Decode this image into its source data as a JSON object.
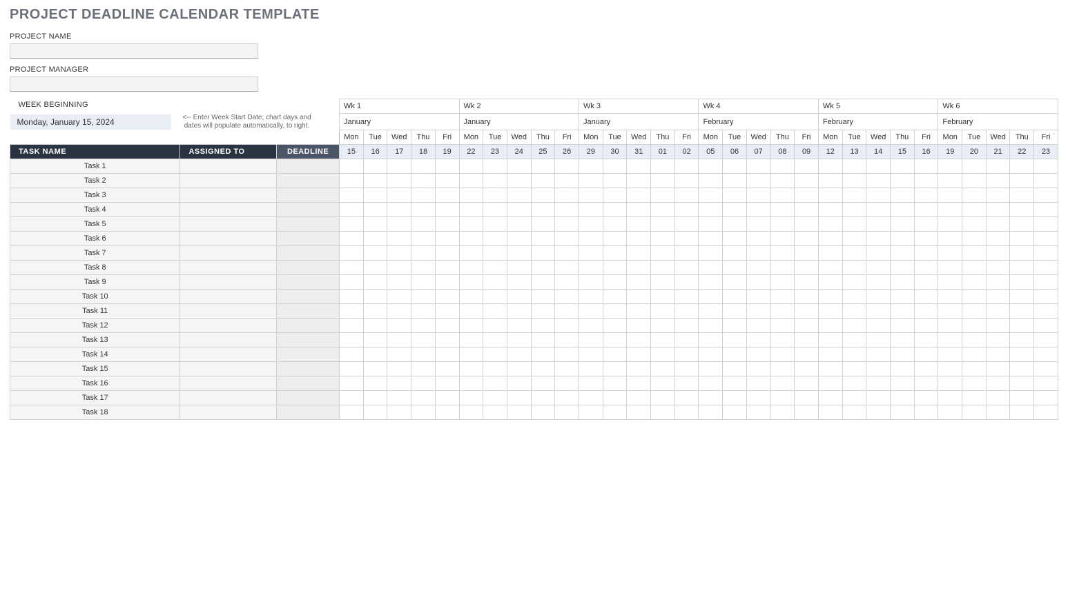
{
  "title": "PROJECT DEADLINE CALENDAR TEMPLATE",
  "labels": {
    "project_name": "PROJECT NAME",
    "project_manager": "PROJECT MANAGER",
    "week_beginning": "WEEK BEGINNING",
    "date_hint": "<-- Enter Week Start Date; chart days and dates will populate automatically, to right."
  },
  "inputs": {
    "project_name": "",
    "project_manager": "",
    "week_beginning": "Monday, January 15, 2024"
  },
  "columns": {
    "task": "TASK NAME",
    "assigned": "ASSIGNED TO",
    "deadline": "DEADLINE"
  },
  "weeks": [
    {
      "label": "Wk 1",
      "month": "January",
      "days": [
        "Mon",
        "Tue",
        "Wed",
        "Thu",
        "Fri"
      ],
      "dates": [
        "15",
        "16",
        "17",
        "18",
        "19"
      ]
    },
    {
      "label": "Wk 2",
      "month": "January",
      "days": [
        "Mon",
        "Tue",
        "Wed",
        "Thu",
        "Fri"
      ],
      "dates": [
        "22",
        "23",
        "24",
        "25",
        "26"
      ]
    },
    {
      "label": "Wk 3",
      "month": "January",
      "days": [
        "Mon",
        "Tue",
        "Wed",
        "Thu",
        "Fri"
      ],
      "dates": [
        "29",
        "30",
        "31",
        "01",
        "02"
      ]
    },
    {
      "label": "Wk 4",
      "month": "February",
      "days": [
        "Mon",
        "Tue",
        "Wed",
        "Thu",
        "Fri"
      ],
      "dates": [
        "05",
        "06",
        "07",
        "08",
        "09"
      ]
    },
    {
      "label": "Wk 5",
      "month": "February",
      "days": [
        "Mon",
        "Tue",
        "Wed",
        "Thu",
        "Fri"
      ],
      "dates": [
        "12",
        "13",
        "14",
        "15",
        "16"
      ]
    },
    {
      "label": "Wk 6",
      "month": "February",
      "days": [
        "Mon",
        "Tue",
        "Wed",
        "Thu",
        "Fri"
      ],
      "dates": [
        "19",
        "20",
        "21",
        "22",
        "23"
      ]
    }
  ],
  "tasks": [
    {
      "name": "Task 1",
      "assigned": "",
      "deadline": ""
    },
    {
      "name": "Task 2",
      "assigned": "",
      "deadline": ""
    },
    {
      "name": "Task 3",
      "assigned": "",
      "deadline": ""
    },
    {
      "name": "Task 4",
      "assigned": "",
      "deadline": ""
    },
    {
      "name": "Task 5",
      "assigned": "",
      "deadline": ""
    },
    {
      "name": "Task 6",
      "assigned": "",
      "deadline": ""
    },
    {
      "name": "Task 7",
      "assigned": "",
      "deadline": ""
    },
    {
      "name": "Task 8",
      "assigned": "",
      "deadline": ""
    },
    {
      "name": "Task 9",
      "assigned": "",
      "deadline": ""
    },
    {
      "name": "Task 10",
      "assigned": "",
      "deadline": ""
    },
    {
      "name": "Task 11",
      "assigned": "",
      "deadline": ""
    },
    {
      "name": "Task 12",
      "assigned": "",
      "deadline": ""
    },
    {
      "name": "Task 13",
      "assigned": "",
      "deadline": ""
    },
    {
      "name": "Task 14",
      "assigned": "",
      "deadline": ""
    },
    {
      "name": "Task 15",
      "assigned": "",
      "deadline": ""
    },
    {
      "name": "Task 16",
      "assigned": "",
      "deadline": ""
    },
    {
      "name": "Task 17",
      "assigned": "",
      "deadline": ""
    },
    {
      "name": "Task 18",
      "assigned": "",
      "deadline": ""
    }
  ]
}
